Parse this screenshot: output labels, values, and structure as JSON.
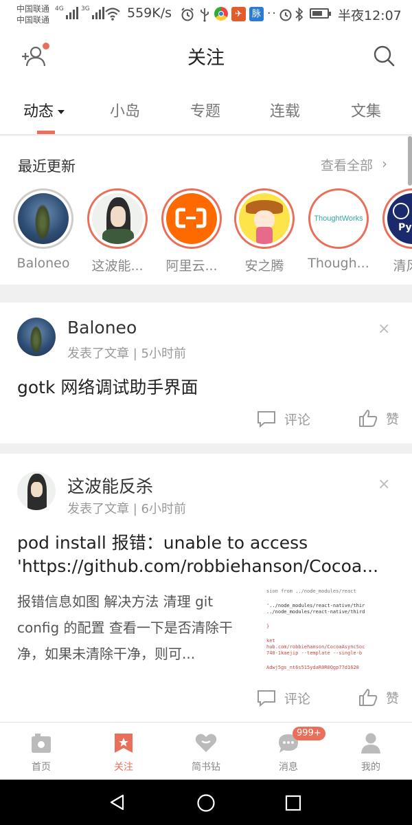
{
  "status_bar": {
    "carrier_1": "中国联通",
    "carrier_2": "中国联通",
    "net_1": "4G",
    "net_2": "3G",
    "speed": "559K/s",
    "time": "半夜12:07",
    "app_badges": [
      "脉"
    ]
  },
  "header": {
    "title": "关注",
    "add_user_icon": "add-user-icon",
    "search_icon": "search-icon"
  },
  "tabs": [
    {
      "label": "动态",
      "active": true
    },
    {
      "label": "小岛",
      "active": false
    },
    {
      "label": "专题",
      "active": false
    },
    {
      "label": "连载",
      "active": false
    },
    {
      "label": "文集",
      "active": false
    }
  ],
  "recent": {
    "heading": "最近更新",
    "view_all": "查看全部",
    "chevron": "›",
    "users": [
      {
        "name": "Baloneo"
      },
      {
        "name": "这波能..."
      },
      {
        "name": "阿里云..."
      },
      {
        "name": "安之腾"
      },
      {
        "name": "Though..."
      },
      {
        "name": "清风略"
      }
    ],
    "thoughtworks_logo_text": "ThoughtWorks",
    "last_avatar_text": "Py"
  },
  "feed": [
    {
      "author": "Baloneo",
      "meta": "发表了文章 | 5小时前",
      "title": "gotk 网络调试助手界面",
      "comment_label": "评论",
      "like_label": "赞",
      "close": "×"
    },
    {
      "author": "这波能反杀",
      "meta": "发表了文章 | 6小时前",
      "title_line_1": "pod install 报错：unable to access",
      "title_line_2": "'https://github.com/robbiehanson/Cocoa...",
      "excerpt": "报错信息如图 解决方法 清理 git config 的配置 查看一下是否清除干净，如果未清除干净，则可...",
      "comment_label": "评论",
      "like_label": "赞",
      "close": "×",
      "thumb_lines": [
        "sion  from  ../node_modules/react",
        "'../node_modules/react-native/thir",
        "../node_modules/react-native/third",
        "",
        "}",
        "",
        "ket",
        "hub.com/robbiehanson/CocoaAsyncSoc",
        "740-1kaejip --template --single-b",
        "",
        "Adwj5gs_nt6s515ydaR0R0Qgp77d1628"
      ]
    }
  ],
  "bottom_nav": [
    {
      "label": "首页",
      "icon": "home-icon",
      "active": false
    },
    {
      "label": "关注",
      "icon": "bookmark-star-icon",
      "active": true
    },
    {
      "label": "简书钻",
      "icon": "heart-icon",
      "active": false
    },
    {
      "label": "消息",
      "icon": "chat-icon",
      "active": false,
      "badge": "999+"
    },
    {
      "label": "我的",
      "icon": "person-icon",
      "active": false
    }
  ],
  "colors": {
    "accent": "#ea6f5a",
    "text": "#333333",
    "muted": "#999999"
  }
}
